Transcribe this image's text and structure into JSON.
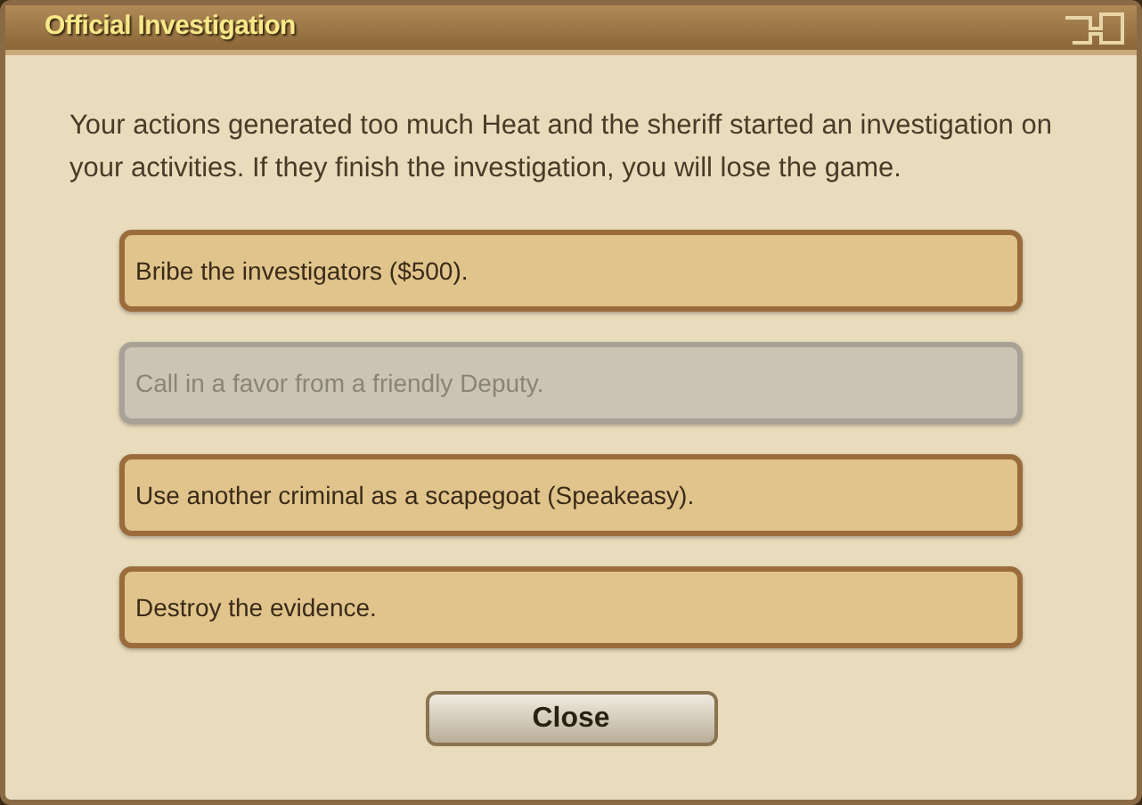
{
  "window": {
    "title": "Official Investigation"
  },
  "message": "Your actions generated too much Heat and the sheriff started an investigation on your activities. If they finish the investigation, you will lose the game.",
  "options": [
    {
      "label": "Bribe the investigators ($500).",
      "disabled": false
    },
    {
      "label": "Call in a favor from a friendly Deputy.",
      "disabled": true
    },
    {
      "label": "Use another criminal as a scapegoat (Speakeasy).",
      "disabled": false
    },
    {
      "label": "Destroy the evidence.",
      "disabled": false
    }
  ],
  "buttons": [
    "Close"
  ]
}
